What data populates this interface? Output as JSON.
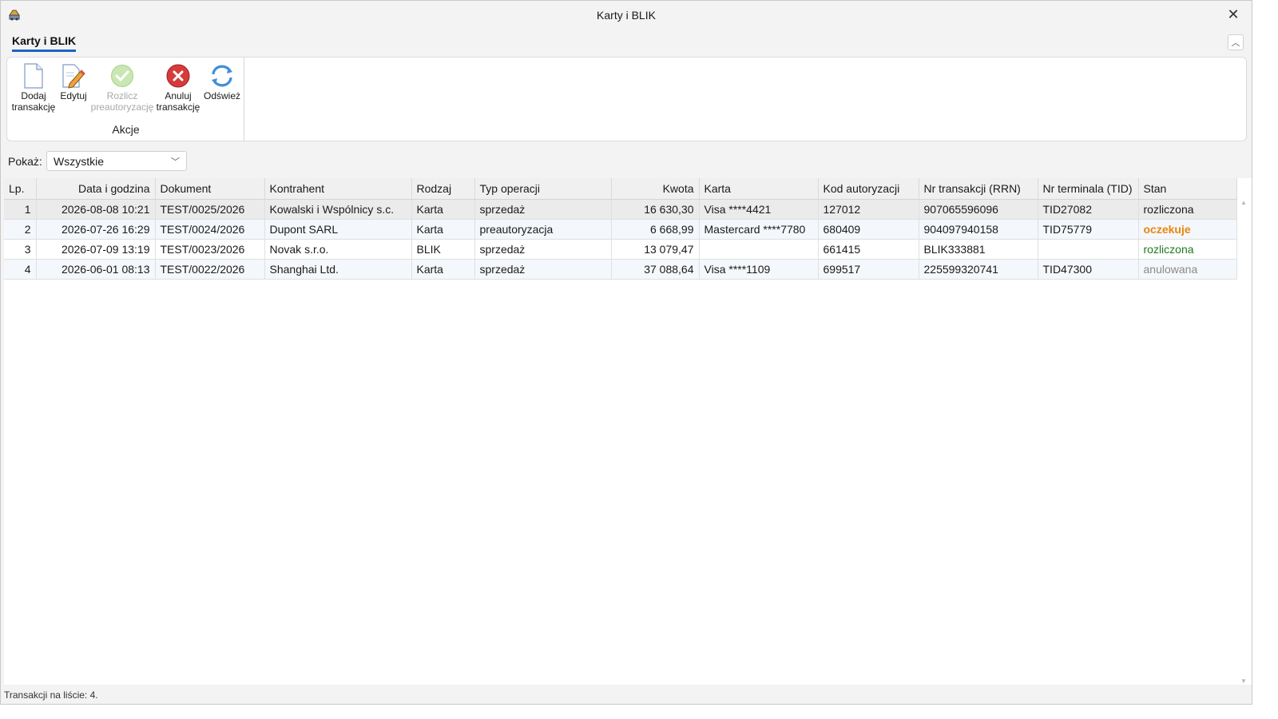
{
  "window": {
    "title": "Karty i BLIK"
  },
  "ribbon": {
    "tab_label": "Karty i BLIK",
    "buttons": [
      {
        "line1": "Dodaj",
        "line2": "transakcję",
        "icon": "new-document-icon",
        "enabled": true
      },
      {
        "line1": "Edytuj",
        "line2": "",
        "icon": "edit-pencil-icon",
        "enabled": true
      },
      {
        "line1": "Rozlicz",
        "line2": "preautoryzację",
        "icon": "checkmark-icon",
        "enabled": false
      },
      {
        "line1": "Anuluj",
        "line2": "transakcję",
        "icon": "cancel-x-icon",
        "enabled": true
      },
      {
        "line1": "Odśwież",
        "line2": "",
        "icon": "refresh-icon",
        "enabled": true
      }
    ],
    "group_label": "Akcje"
  },
  "filter": {
    "label": "Pokaż:",
    "value": "Wszystkie"
  },
  "grid": {
    "columns": [
      "Lp.",
      "Data i godzina",
      "Dokument",
      "Kontrahent",
      "Rodzaj",
      "Typ operacji",
      "Kwota",
      "Karta",
      "Kod autoryzacji",
      "Nr transakcji (RRN)",
      "Nr terminala (TID)",
      "Stan"
    ],
    "rows": [
      {
        "lp": "1",
        "date": "2026-08-08 10:21",
        "doc": "TEST/0025/2026",
        "contractor": "Kowalski i Wspólnicy s.c.",
        "kind": "Karta",
        "op": "sprzedaż",
        "amount": "16 630,30",
        "card": "Visa ****4421",
        "auth": "127012",
        "rrn": "907065596096",
        "tid": "TID27082",
        "state": "rozliczona"
      },
      {
        "lp": "2",
        "date": "2026-07-26 16:29",
        "doc": "TEST/0024/2026",
        "contractor": "Dupont SARL",
        "kind": "Karta",
        "op": "preautoryzacja",
        "amount": "6 668,99",
        "card": "Mastercard ****7780",
        "auth": "680409",
        "rrn": "904097940158",
        "tid": "TID75779",
        "state": "oczekuje"
      },
      {
        "lp": "3",
        "date": "2026-07-09 13:19",
        "doc": "TEST/0023/2026",
        "contractor": "Novak s.r.o.",
        "kind": "BLIK",
        "op": "sprzedaż",
        "amount": "13 079,47",
        "card": "",
        "auth": "661415",
        "rrn": "BLIK333881",
        "tid": "",
        "state": "rozliczona"
      },
      {
        "lp": "4",
        "date": "2026-06-01 08:13",
        "doc": "TEST/0022/2026",
        "contractor": "Shanghai Ltd.",
        "kind": "Karta",
        "op": "sprzedaż",
        "amount": "37 088,64",
        "card": "Visa ****1109",
        "auth": "699517",
        "rrn": "225599320741",
        "tid": "TID47300",
        "state": "anulowana"
      }
    ]
  },
  "status": {
    "text": "Transakcji na liście: 4."
  },
  "colors": {
    "accent": "#1e63c6",
    "settled": "#1e7a1e",
    "pending": "#e8870c",
    "cancelled": "#8a8a8a"
  }
}
